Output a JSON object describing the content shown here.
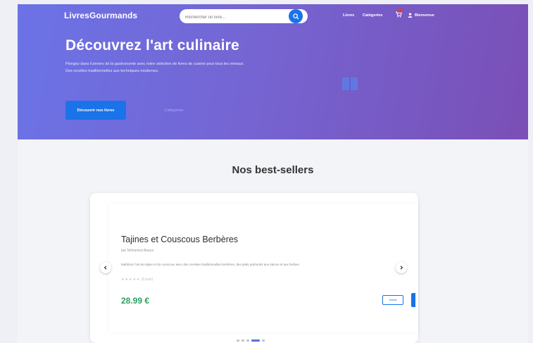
{
  "header": {
    "brand": "LivresGourmands",
    "search": {
      "placeholder": "Rechercher un livre..."
    },
    "nav": [
      {
        "label": "Livres"
      },
      {
        "label": "Catégories"
      }
    ],
    "user_label": "Bienvenue"
  },
  "hero": {
    "title": "Découvrez l'art culinaire",
    "text": "Plongez dans l'univers de la gastronomie avec notre sélection de livres de cuisine pour tous les niveaux. Des recettes traditionnelles aux techniques modernes.",
    "primary_button": "Découvrir nos livres",
    "secondary_button": "Catégories"
  },
  "bestsellers": {
    "title": "Nos best-sellers",
    "book": {
      "title": "Tajines et Couscous Berbères",
      "author": "par Mohamed Alaoui",
      "description": "Maîtrisez l'art du tajine et du couscous avec des recettes traditionnelles berbères, des plats parfumés aux épices et aux herbes.",
      "rating_stars": "★★★★★",
      "rating_label": "(0 avis)",
      "price": "28.99 €",
      "detail_button": "Détails"
    },
    "slide_count": 5,
    "active_slide": 3
  },
  "colors": {
    "accent": "#1a73e8",
    "price": "#2e9e62",
    "hero_start": "#6b73e6",
    "hero_end": "#7a4fb6"
  },
  "icons": {
    "search": "search-icon",
    "cart": "cart-icon",
    "user": "user-icon",
    "hero": "book-stack-icon",
    "prev": "chevron-left-icon",
    "next": "chevron-right-icon"
  }
}
